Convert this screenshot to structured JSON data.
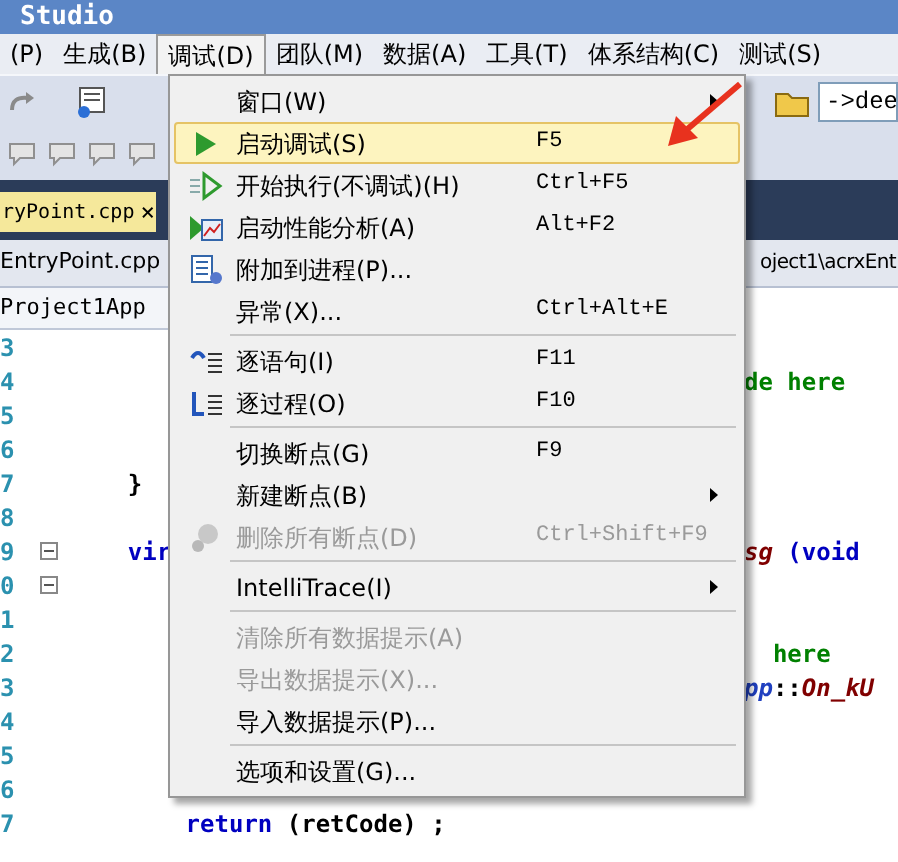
{
  "window": {
    "title": "Studio"
  },
  "menu_bar": [
    {
      "label": "(P)",
      "selected": false
    },
    {
      "label": "生成(B)",
      "selected": false
    },
    {
      "label": "调试(D)",
      "selected": true
    },
    {
      "label": "团队(M)",
      "selected": false
    },
    {
      "label": "数据(A)",
      "selected": false
    },
    {
      "label": "工具(T)",
      "selected": false
    },
    {
      "label": "体系结构(C)",
      "selected": false
    },
    {
      "label": "测试(S)",
      "selected": false
    }
  ],
  "toolbar": {
    "address_field": "->dee"
  },
  "tabs": [
    {
      "label": "ryPoint.cpp",
      "selected": true,
      "close": "×"
    }
  ],
  "path_bar": {
    "file": "EntryPoint.cpp",
    "path": "oject1\\acrxEnt"
  },
  "class_bar": {
    "class": "Project1App"
  },
  "code_lines": [
    {
      "number": "3"
    },
    {
      "number": "4",
      "right": [
        {
          "text": "de here",
          "kind": "comment"
        }
      ]
    },
    {
      "number": "5"
    },
    {
      "number": "6"
    },
    {
      "number": "7",
      "left": [
        {
          "text": "    }",
          "kind": "plain"
        }
      ]
    },
    {
      "number": "8"
    },
    {
      "number": "9",
      "collapsible": true,
      "left": [
        {
          "text": "    vir",
          "kind": "keyword"
        }
      ],
      "right": [
        {
          "text": "sg",
          "kind": "function"
        },
        {
          "text": " (void",
          "kind": "keyword"
        }
      ]
    },
    {
      "number": "0",
      "collapsible": true
    },
    {
      "number": "1"
    },
    {
      "number": "2",
      "right": [
        {
          "text": "  here",
          "kind": "comment"
        }
      ]
    },
    {
      "number": "3",
      "right": [
        {
          "text": "pp",
          "kind": "class"
        },
        {
          "text": "::",
          "kind": "plain"
        },
        {
          "text": "On_kU",
          "kind": "function"
        }
      ]
    },
    {
      "number": "4"
    },
    {
      "number": "5"
    },
    {
      "number": "6"
    },
    {
      "number": "7",
      "left": [
        {
          "text": "        return",
          "kind": "keyword"
        },
        {
          "text": " (retCode) ;",
          "kind": "plain"
        }
      ]
    }
  ],
  "debug_menu": [
    {
      "kind": "item",
      "label": "窗口(W)",
      "submenu": true,
      "disabled": false,
      "selected": false
    },
    {
      "kind": "item",
      "label": "启动调试(S)",
      "shortcut": "F5",
      "submenu": false,
      "disabled": false,
      "selected": true
    },
    {
      "kind": "item",
      "label": "开始执行(不调试)(H)",
      "shortcut": "Ctrl+F5",
      "submenu": false,
      "disabled": false,
      "selected": false
    },
    {
      "kind": "item",
      "label": "启动性能分析(A)",
      "shortcut": "Alt+F2",
      "submenu": false,
      "disabled": false,
      "selected": false
    },
    {
      "kind": "item",
      "label": "附加到进程(P)...",
      "submenu": false,
      "disabled": false,
      "selected": false
    },
    {
      "kind": "item",
      "label": "异常(X)...",
      "shortcut": "Ctrl+Alt+E",
      "submenu": false,
      "disabled": false,
      "selected": false
    },
    {
      "kind": "separator"
    },
    {
      "kind": "item",
      "label": "逐语句(I)",
      "shortcut": "F11",
      "submenu": false,
      "disabled": false,
      "selected": false
    },
    {
      "kind": "item",
      "label": "逐过程(O)",
      "shortcut": "F10",
      "submenu": false,
      "disabled": false,
      "selected": false
    },
    {
      "kind": "separator"
    },
    {
      "kind": "item",
      "label": "切换断点(G)",
      "shortcut": "F9",
      "submenu": false,
      "disabled": false,
      "selected": false
    },
    {
      "kind": "item",
      "label": "新建断点(B)",
      "submenu": true,
      "disabled": false,
      "selected": false
    },
    {
      "kind": "item",
      "label": "删除所有断点(D)",
      "shortcut": "Ctrl+Shift+F9",
      "submenu": false,
      "disabled": true,
      "selected": false
    },
    {
      "kind": "separator"
    },
    {
      "kind": "item",
      "label": "IntelliTrace(I)",
      "submenu": true,
      "disabled": false,
      "selected": false
    },
    {
      "kind": "separator"
    },
    {
      "kind": "item",
      "label": "清除所有数据提示(A)",
      "submenu": false,
      "disabled": true,
      "selected": false
    },
    {
      "kind": "item",
      "label": "导出数据提示(X)...",
      "submenu": false,
      "disabled": true,
      "selected": false
    },
    {
      "kind": "item",
      "label": "导入数据提示(P)...",
      "submenu": false,
      "disabled": false,
      "selected": false
    },
    {
      "kind": "separator"
    },
    {
      "kind": "item",
      "label": "选项和设置(G)...",
      "submenu": false,
      "disabled": false,
      "selected": false
    }
  ]
}
